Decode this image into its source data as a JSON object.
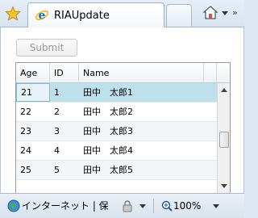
{
  "browser": {
    "tab_title": "RIAUpdate",
    "icons": {
      "favorites": "favorites-star-icon",
      "tab": "ie-logo-icon",
      "home": "home-icon"
    }
  },
  "page": {
    "submit_label": "Submit",
    "submit_enabled": false
  },
  "grid": {
    "columns": [
      "Age",
      "ID",
      "Name"
    ],
    "rows": [
      {
        "age": "21",
        "id": "1",
        "name": "田中　太郎1",
        "selected": true
      },
      {
        "age": "22",
        "id": "2",
        "name": "田中　太郎2",
        "selected": false
      },
      {
        "age": "23",
        "id": "3",
        "name": "田中　太郎3",
        "selected": false
      },
      {
        "age": "24",
        "id": "4",
        "name": "田中　太郎4",
        "selected": false
      },
      {
        "age": "25",
        "id": "5",
        "name": "田中　太郎5",
        "selected": false
      }
    ]
  },
  "statusbar": {
    "zone_text": "インターネット | 保",
    "zoom_text": "100%"
  },
  "colors": {
    "selected_row": "#bde0ea",
    "accent": "#1f6fc5"
  }
}
